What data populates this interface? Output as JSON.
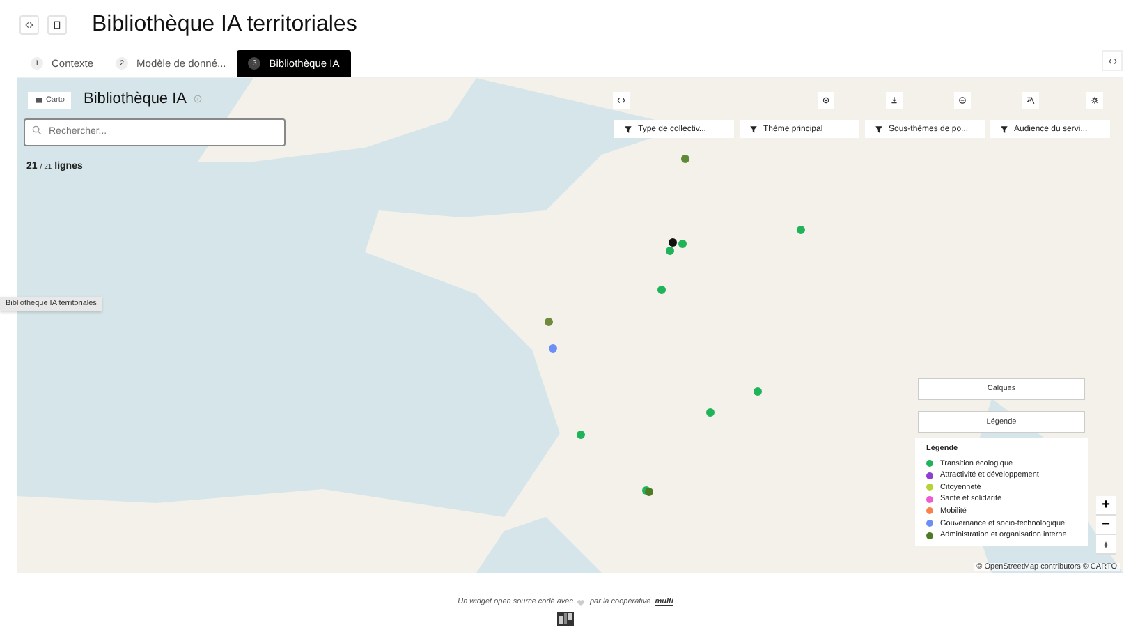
{
  "header": {
    "title": "Bibliothèque IA territoriales"
  },
  "tabs": [
    {
      "number": "1",
      "label": "Contexte",
      "selected": false
    },
    {
      "number": "2",
      "label": "Modèle de donné...",
      "selected": false
    },
    {
      "number": "3",
      "label": "Bibliothèque IA",
      "selected": true
    }
  ],
  "map_panel": {
    "mode_button": "Carto",
    "title": "Bibliothèque IA",
    "search": {
      "placeholder": "Rechercher..."
    },
    "count": {
      "shown": "21",
      "total": "/ 21",
      "unit": "lignes"
    },
    "filters": [
      "Type de collectiv...",
      "Thème principal",
      "Sous-thèmes de po...",
      "Audience du servi..."
    ],
    "markers": [
      {
        "color": "#5e8a35"
      },
      {
        "color": "#111111"
      },
      {
        "color": "#1fb35a"
      },
      {
        "color": "#1fb35a"
      },
      {
        "color": "#1fb35a"
      },
      {
        "color": "#1fb35a"
      },
      {
        "color": "#6e8a3a"
      },
      {
        "color": "#6b8ff5"
      },
      {
        "color": "#1fb35a"
      },
      {
        "color": "#1fb35a"
      },
      {
        "color": "#1fb35a"
      },
      {
        "color": "#1fb35a"
      },
      {
        "color": "#4c7a25"
      }
    ],
    "layers_button": "Calques",
    "legend_button": "Légende",
    "legend": {
      "title": "Légende",
      "items": [
        {
          "label": "Transition écologique",
          "color": "#1fb35a"
        },
        {
          "label": "Attractivité et développement",
          "color": "#8e3fd1"
        },
        {
          "label": "Citoyenneté",
          "color": "#b5d334"
        },
        {
          "label": "Santé et solidarité",
          "color": "#f05ad1"
        },
        {
          "label": "Mobilité",
          "color": "#f7834a"
        },
        {
          "label": "Gouvernance et socio-technologique",
          "color": "#6b8ff5"
        },
        {
          "label": "Administration et organisation interne",
          "color": "#4c7a25"
        }
      ]
    },
    "zoom": {
      "in": "+",
      "out": "−"
    },
    "attribution": "© OpenStreetMap contributors © CARTO"
  },
  "tooltip": "Bibliothèque IA territoriales",
  "footer": {
    "text_before": "Un widget open source codé avec",
    "text_after": "par la coopérative",
    "link": "multi"
  }
}
